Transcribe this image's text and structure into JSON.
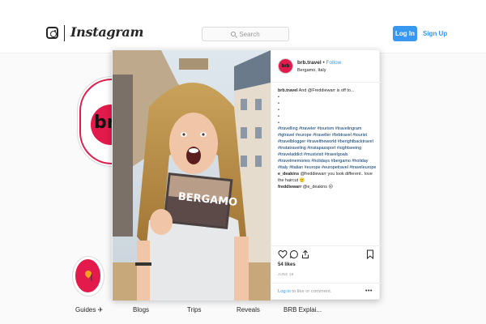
{
  "nav": {
    "logo_text": "Instagram",
    "search_placeholder": "Search",
    "login_label": "Log In",
    "signup_label": "Sign Up"
  },
  "profile": {
    "avatar_text": "brb"
  },
  "highlights": [
    {
      "label": "Guides ✈"
    },
    {
      "label": "Blogs"
    },
    {
      "label": "Trips"
    },
    {
      "label": "Reveals"
    },
    {
      "label": "BRB Explai..."
    }
  ],
  "post": {
    "photo_text": "BERGAMO",
    "avatar_text": "brb",
    "username": "brb.travel",
    "separator": "•",
    "follow_label": "Follow",
    "location": "Bergamo, Italy",
    "caption": {
      "username": "brb.travel",
      "text": "And @Freddiewarr is off to...",
      "bullets": [
        "•",
        "•",
        "•",
        "•",
        "•"
      ],
      "hashtags": "#travelling #traveler #tourism #travelingram #igtravel #europe #traveller #brbtravel #tourist #travelblogger #traveltheworld #berightbacktravel #instatraveling #instapassport #sightseeing #traveladdict #mustvisit #travelgoals #travelmemories #holidays #bergamo #holiday #italy #italian #europe #europetravel #traveleurope"
    },
    "comments": [
      {
        "username": "e_deakins",
        "text": "@freddiewarr you look different.. love the haircut 🙂"
      },
      {
        "username": "freddiewarr",
        "text": "@e_deakins 😜"
      }
    ],
    "likes": "54 likes",
    "date": "JUNE 18",
    "footer": {
      "login_link": "Log in",
      "rest": " to like or comment."
    },
    "more_label": "•••"
  },
  "colors": {
    "accent": "#3897f0",
    "brand": "#e31b4c",
    "hashtag": "#003569"
  },
  "icons": [
    "instagram-icon",
    "search-icon",
    "heart-icon",
    "comment-icon",
    "share-icon",
    "bookmark-icon",
    "more-icon",
    "pin-icon"
  ]
}
